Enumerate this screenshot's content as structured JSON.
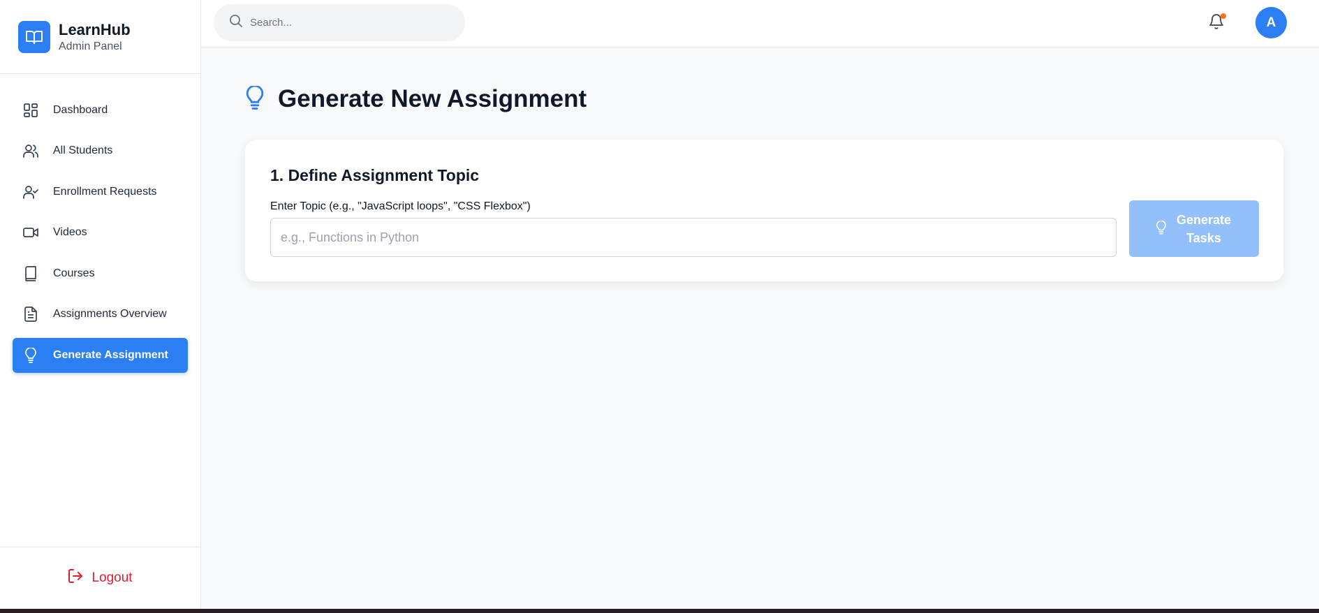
{
  "brand": {
    "title": "LearnHub",
    "subtitle": "Admin Panel",
    "icon": "book-open-icon"
  },
  "search": {
    "placeholder": "Search..."
  },
  "header": {
    "avatar_initial": "A",
    "notification_dot": true
  },
  "sidebar": {
    "items": [
      {
        "label": "Dashboard",
        "icon": "dashboard-icon",
        "active": false
      },
      {
        "label": "All Students",
        "icon": "users-icon",
        "active": false
      },
      {
        "label": "Enrollment Requests",
        "icon": "user-check-icon",
        "active": false
      },
      {
        "label": "Videos",
        "icon": "video-icon",
        "active": false
      },
      {
        "label": "Courses",
        "icon": "book-icon",
        "active": false
      },
      {
        "label": "Assignments Overview",
        "icon": "file-text-icon",
        "active": false
      },
      {
        "label": "Generate Assignment",
        "icon": "lightbulb-icon",
        "active": true
      }
    ],
    "logout_label": "Logout"
  },
  "main": {
    "title": "Generate New Assignment",
    "card": {
      "heading": "1. Define Assignment Topic",
      "field_label": "Enter Topic (e.g., \"JavaScript loops\", \"CSS Flexbox\")",
      "input_value": "",
      "input_placeholder": "e.g., Functions in Python",
      "button_label": "Generate Tasks",
      "button_disabled": true
    }
  },
  "colors": {
    "accent": "#2b7ff2",
    "accent_disabled": "#93c0fb",
    "danger": "#e11d2e",
    "notification": "#f97316",
    "page_bg": "#f8f9fb"
  }
}
